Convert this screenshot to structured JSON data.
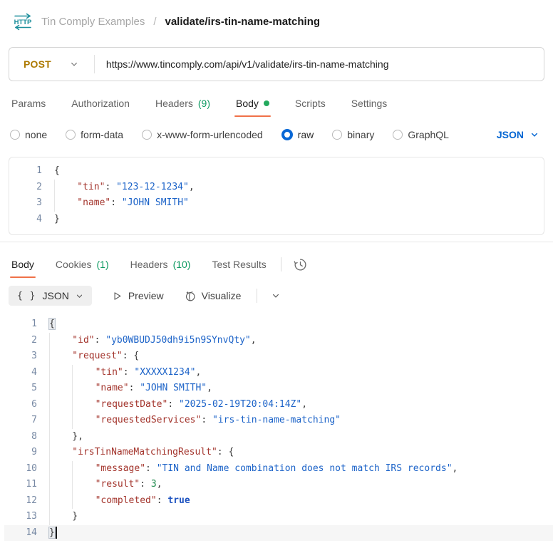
{
  "header": {
    "collection": "Tin Comply Examples",
    "separator": "/",
    "request_name": "validate/irs-tin-name-matching",
    "method_icon": "http-request-icon",
    "icon_color": "#1b8e9b"
  },
  "request_bar": {
    "method": "POST",
    "method_color": "#ad7a03",
    "url": "https://www.tincomply.com/api/v1/validate/irs-tin-name-matching"
  },
  "request_tabs": [
    {
      "label": "Params"
    },
    {
      "label": "Authorization"
    },
    {
      "label": "Headers",
      "count": "(9)"
    },
    {
      "label": "Body",
      "active": true,
      "dot": true
    },
    {
      "label": "Scripts"
    },
    {
      "label": "Settings"
    }
  ],
  "body_modes": [
    {
      "label": "none"
    },
    {
      "label": "form-data"
    },
    {
      "label": "x-www-form-urlencoded"
    },
    {
      "label": "raw",
      "selected": true
    },
    {
      "label": "binary"
    },
    {
      "label": "GraphQL"
    }
  ],
  "body_language": "JSON",
  "request_editor": {
    "lines": [
      {
        "n": 1,
        "ind": 0,
        "tok": [
          [
            "p",
            "{"
          ]
        ]
      },
      {
        "n": 2,
        "ind": 1,
        "tok": [
          [
            "k",
            "\"tin\""
          ],
          [
            "p",
            ": "
          ],
          [
            "s",
            "\"123-12-1234\""
          ],
          [
            "p",
            ","
          ]
        ]
      },
      {
        "n": 3,
        "ind": 1,
        "tok": [
          [
            "k",
            "\"name\""
          ],
          [
            "p",
            ": "
          ],
          [
            "s",
            "\"JOHN SMITH\""
          ]
        ]
      },
      {
        "n": 4,
        "ind": 0,
        "tok": [
          [
            "p",
            "}"
          ]
        ]
      }
    ]
  },
  "response_tabs": [
    {
      "label": "Body",
      "active": true
    },
    {
      "label": "Cookies",
      "count": "(1)"
    },
    {
      "label": "Headers",
      "count": "(10)"
    },
    {
      "label": "Test Results"
    }
  ],
  "response_toolbar": {
    "braces_icon": "{ }",
    "language": "JSON",
    "preview": "Preview",
    "visualize": "Visualize"
  },
  "response_editor": {
    "lines": [
      {
        "n": 1,
        "ind": 0,
        "tok": [
          [
            "bm",
            "{"
          ]
        ]
      },
      {
        "n": 2,
        "ind": 1,
        "tok": [
          [
            "k",
            "\"id\""
          ],
          [
            "p",
            ": "
          ],
          [
            "s",
            "\"yb0WBUDJ50dh9i5n9SYnvQty\""
          ],
          [
            "p",
            ","
          ]
        ]
      },
      {
        "n": 3,
        "ind": 1,
        "tok": [
          [
            "k",
            "\"request\""
          ],
          [
            "p",
            ": {"
          ]
        ]
      },
      {
        "n": 4,
        "ind": 2,
        "tok": [
          [
            "k",
            "\"tin\""
          ],
          [
            "p",
            ": "
          ],
          [
            "s",
            "\"XXXXX1234\""
          ],
          [
            "p",
            ","
          ]
        ]
      },
      {
        "n": 5,
        "ind": 2,
        "tok": [
          [
            "k",
            "\"name\""
          ],
          [
            "p",
            ": "
          ],
          [
            "s",
            "\"JOHN SMITH\""
          ],
          [
            "p",
            ","
          ]
        ]
      },
      {
        "n": 6,
        "ind": 2,
        "tok": [
          [
            "k",
            "\"requestDate\""
          ],
          [
            "p",
            ": "
          ],
          [
            "s",
            "\"2025-02-19T20:04:14Z\""
          ],
          [
            "p",
            ","
          ]
        ]
      },
      {
        "n": 7,
        "ind": 2,
        "tok": [
          [
            "k",
            "\"requestedServices\""
          ],
          [
            "p",
            ": "
          ],
          [
            "s",
            "\"irs-tin-name-matching\""
          ]
        ]
      },
      {
        "n": 8,
        "ind": 1,
        "tok": [
          [
            "p",
            "},"
          ]
        ]
      },
      {
        "n": 9,
        "ind": 1,
        "tok": [
          [
            "k",
            "\"irsTinNameMatchingResult\""
          ],
          [
            "p",
            ": {"
          ]
        ]
      },
      {
        "n": 10,
        "ind": 2,
        "tok": [
          [
            "k",
            "\"message\""
          ],
          [
            "p",
            ": "
          ],
          [
            "s",
            "\"TIN and Name combination does not match IRS records\""
          ],
          [
            "p",
            ","
          ]
        ]
      },
      {
        "n": 11,
        "ind": 2,
        "tok": [
          [
            "k",
            "\"result\""
          ],
          [
            "p",
            ": "
          ],
          [
            "n",
            "3"
          ],
          [
            "p",
            ","
          ]
        ]
      },
      {
        "n": 12,
        "ind": 2,
        "tok": [
          [
            "k",
            "\"completed\""
          ],
          [
            "p",
            ": "
          ],
          [
            "b",
            "true"
          ]
        ]
      },
      {
        "n": 13,
        "ind": 1,
        "tok": [
          [
            "p",
            "}"
          ]
        ]
      },
      {
        "n": 14,
        "ind": 0,
        "tok": [
          [
            "bm",
            "}"
          ]
        ],
        "cursor": true,
        "active": true
      }
    ]
  },
  "colors": {
    "accent_orange": "#f07148",
    "count_green": "#0e9a62",
    "unsaved_dot_green": "#23a95d",
    "link_blue": "#0265d2",
    "selected_radio_blue": "#0968d6",
    "method_amber": "#ad7a03",
    "http_icon_teal": "#1b8e9b"
  }
}
